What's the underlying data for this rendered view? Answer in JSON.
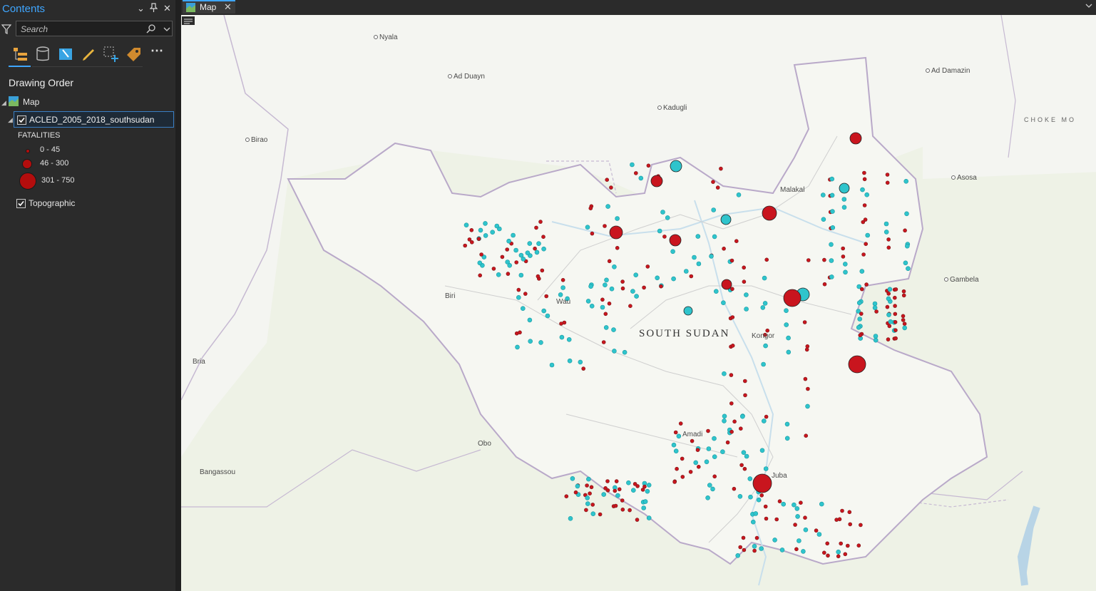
{
  "contents_pane": {
    "title": "Contents",
    "search": {
      "placeholder": "Search",
      "value": ""
    },
    "section_title": "Drawing Order",
    "map_node": "Map",
    "layer": {
      "name": "ACLED_2005_2018_southsudan",
      "checked": true
    },
    "legend": {
      "field": "FATALITIES",
      "classes": [
        {
          "label": "0 - 45"
        },
        {
          "label": "46 - 300"
        },
        {
          "label": "301 - 750"
        }
      ],
      "symbol_color": "#b30d0d"
    },
    "basemap": {
      "name": "Topographic",
      "checked": true
    }
  },
  "map_tab": {
    "label": "Map"
  },
  "map": {
    "country_label": "SOUTH SUDAN",
    "region_label": "CHOKE MO",
    "places": [
      "Nyala",
      "Ad Duayn",
      "Kadugli",
      "Ad Damazin",
      "Birao",
      "Malakal",
      "Asosa",
      "Gambela",
      "Biri",
      "Wau",
      "Kongor",
      "Bria",
      "Amadi",
      "Obo",
      "Juba",
      "Bangassou"
    ],
    "colors": {
      "fatality_point": "#c9151e",
      "event_point": "#2fc4cc",
      "border": "#b9a9c9",
      "water": "#c8dfec"
    }
  }
}
